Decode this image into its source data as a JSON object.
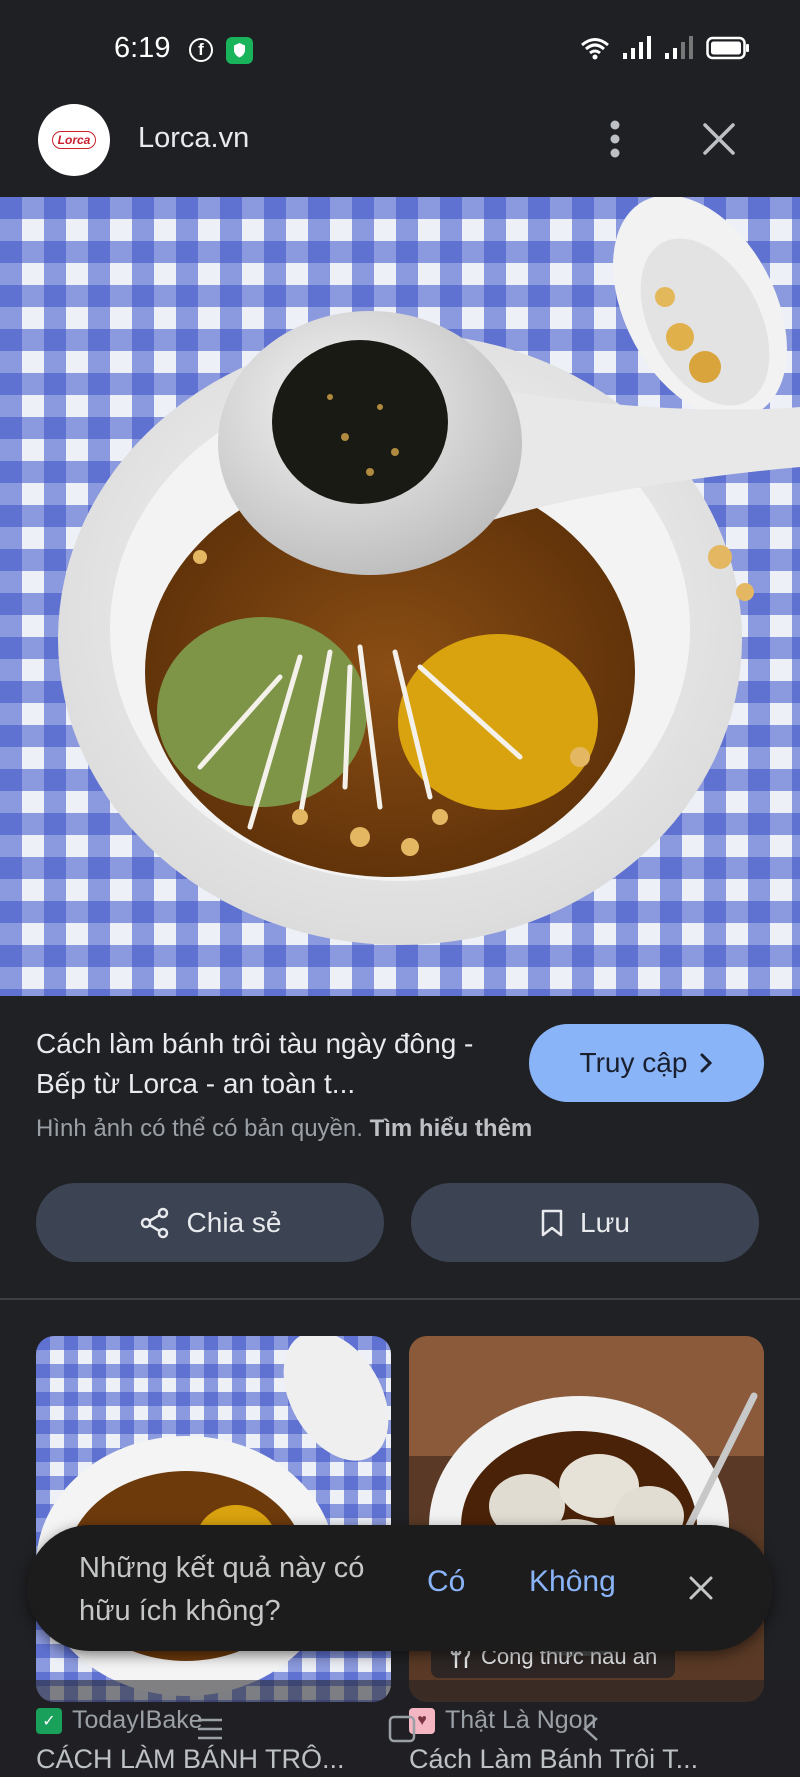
{
  "status_bar": {
    "time": "6:19",
    "icons": [
      "facebook-icon",
      "shield-icon",
      "wifi-icon",
      "signal-icon",
      "signal-icon",
      "battery-icon"
    ]
  },
  "header": {
    "logo_text": "Lorca",
    "site_name": "Lorca.vn",
    "more_icon": "more-vert-icon",
    "close_icon": "close-icon"
  },
  "result": {
    "title": "Cách làm bánh trôi tàu ngày đông - Bếp từ Lorca - an toàn t...",
    "visit_label": "Truy cập",
    "copyright_text": "Hình ảnh có thể có bản quyền.",
    "learn_more": "Tìm hiểu thêm"
  },
  "actions": {
    "share_label": "Chia sẻ",
    "save_label": "Lưu"
  },
  "related": [
    {
      "source": "TodayIBake",
      "title": "CÁCH LÀM BÁNH TRÔ...",
      "badge": ""
    },
    {
      "source": "Thật Là Ngon",
      "title": "Cách Làm Bánh Trôi T...",
      "badge": "Công thức nấu ăn"
    }
  ],
  "feedback": {
    "question": "Những kết quả này có hữu ích không?",
    "yes": "Có",
    "no": "Không"
  },
  "colors": {
    "background": "#202124",
    "accent": "#8ab4f8",
    "button_bg": "#3c4453"
  }
}
